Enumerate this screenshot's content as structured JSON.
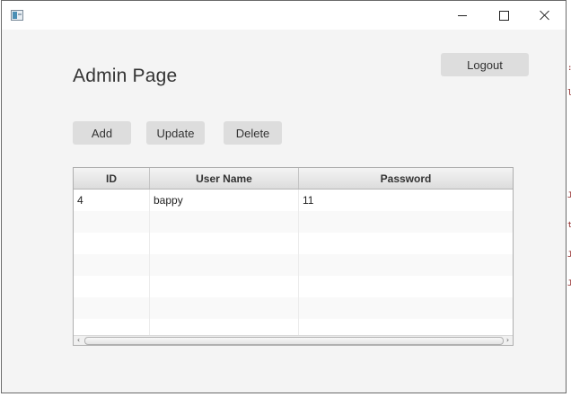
{
  "window": {
    "icon": "app-window-icon",
    "controls": {
      "minimize_icon": "minimize-icon",
      "maximize_icon": "maximize-icon",
      "close_icon": "close-icon"
    }
  },
  "page": {
    "title": "Admin Page"
  },
  "toolbar": {
    "logout_label": "Logout",
    "add_label": "Add",
    "update_label": "Update",
    "delete_label": "Delete"
  },
  "table": {
    "columns": [
      "ID",
      "User Name",
      "Password"
    ],
    "rows": [
      {
        "id": "4",
        "user_name": "bappy",
        "password": "11"
      }
    ],
    "scroll_icons": {
      "left": "‹",
      "right": "›"
    }
  },
  "colors": {
    "window_bg": "#f4f4f4",
    "button_bg": "#dddddd",
    "header_bg": "#dcdcdc",
    "text": "#333333"
  },
  "background_fragments": [
    ":",
    "l",
    "J",
    "J",
    "t",
    "J",
    "J",
    "·"
  ]
}
